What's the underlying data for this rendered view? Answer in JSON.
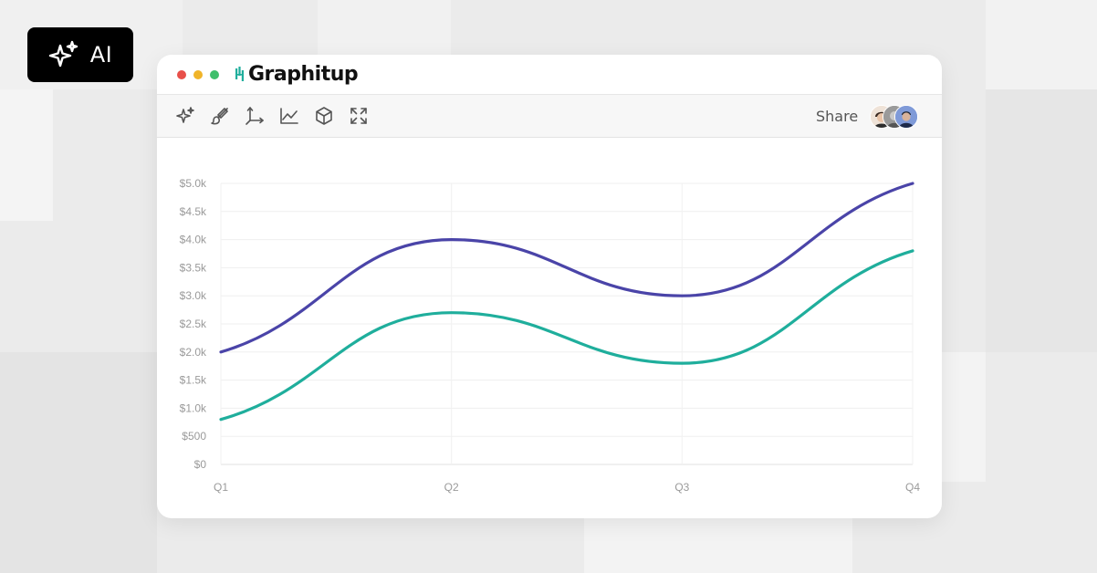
{
  "badge": {
    "label": "AI",
    "icon": "sparkles-icon"
  },
  "window": {
    "controls": {
      "close": "#e8504a",
      "minimize": "#f0b429",
      "maximize": "#3fbf6b"
    },
    "app_name": "Graphitup",
    "brand_color": "#1fae9c"
  },
  "toolbar": {
    "tools": [
      "sparkles-icon",
      "paintbrush-icon",
      "axes-icon",
      "line-chart-icon",
      "cube-icon",
      "expand-icon"
    ],
    "share_label": "Share",
    "avatars": [
      "avatar-1",
      "avatar-2",
      "avatar-3"
    ]
  },
  "chart_data": {
    "type": "line",
    "smooth": true,
    "categories": [
      "Q1",
      "Q2",
      "Q3",
      "Q4"
    ],
    "x_tick_labels": [
      "Q1",
      "Q2",
      "Q3",
      "Q4"
    ],
    "y_tick_labels": [
      "$0",
      "$500",
      "$1.0k",
      "$1.5k",
      "$2.0k",
      "$2.5k",
      "$3.0k",
      "$3.5k",
      "$4.0k",
      "$4.5k",
      "$5.0k"
    ],
    "ylim": [
      0,
      5000
    ],
    "grid": true,
    "series": [
      {
        "color": "#4a44a8",
        "values": [
          2000,
          4000,
          3000,
          5000
        ]
      },
      {
        "color": "#1fae9c",
        "values": [
          800,
          2700,
          1800,
          3800
        ]
      }
    ]
  }
}
